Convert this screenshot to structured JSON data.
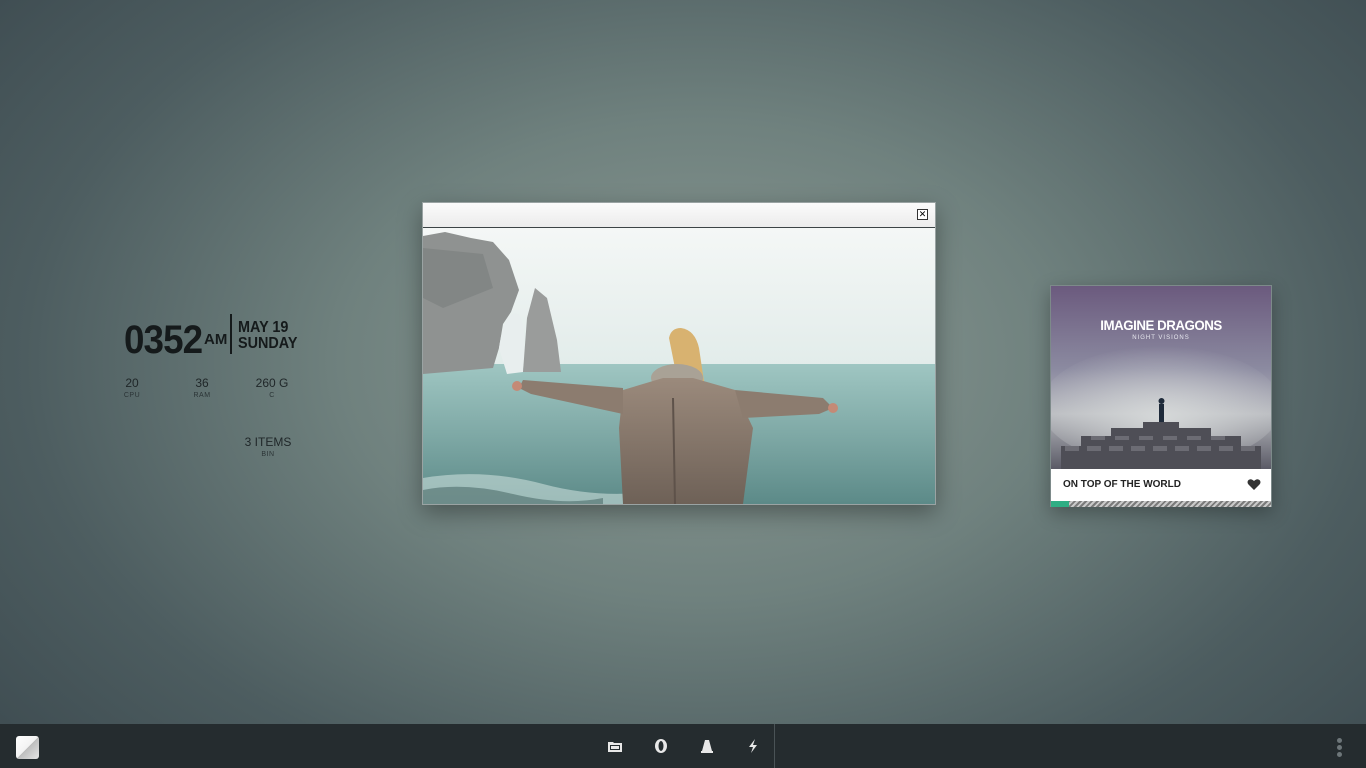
{
  "clock": {
    "time": "0352",
    "ampm": "AM",
    "date": "MAY 19",
    "day": "SUNDAY"
  },
  "stats": [
    {
      "value": "20",
      "label": "CPU"
    },
    {
      "value": "36",
      "label": "RAM"
    },
    {
      "value": "260 G",
      "label": "C"
    }
  ],
  "bin": {
    "value": "3 ITEMS",
    "label": "BIN"
  },
  "viewer": {
    "close_glyph": "✕"
  },
  "music": {
    "band": "IMAGINE DRAGONS",
    "album": "NIGHT VISIONS",
    "track": "ON TOP OF THE WORLD",
    "progress": 0.08,
    "accent": "#2fae84"
  },
  "taskbar": {
    "icons": [
      "start-icon",
      "file-manager-icon",
      "opera-icon",
      "vlc-icon",
      "winamp-icon",
      "menu-dots-icon"
    ]
  }
}
